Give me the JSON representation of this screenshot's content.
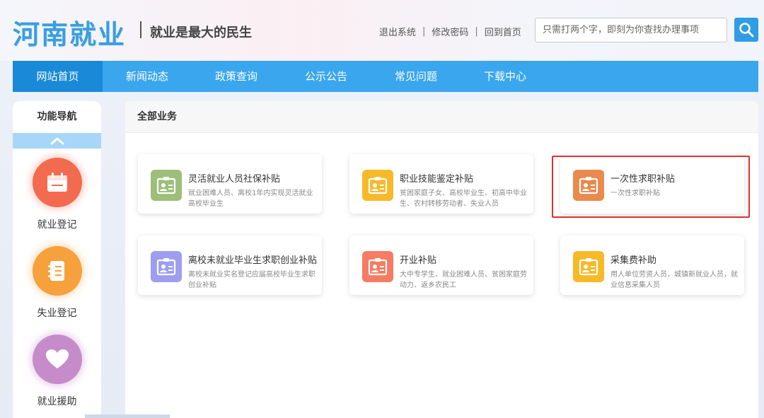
{
  "header": {
    "logo": "河南就业",
    "slogan": "就业是最大的民生",
    "links": [
      "退出系统",
      "修改密码",
      "回到首页"
    ],
    "search_placeholder": "只需打两个字，即刻为你查找办理事项"
  },
  "nav": {
    "items": [
      "网站首页",
      "新闻动态",
      "政策查询",
      "公示公告",
      "常见问题",
      "下载中心"
    ],
    "active_index": 0
  },
  "sidebar": {
    "title": "功能导航",
    "items": [
      {
        "label": "就业登记",
        "icon": "calendar-icon",
        "color": "#f26b4f"
      },
      {
        "label": "失业登记",
        "icon": "notebook-icon",
        "color": "#f7a13c"
      },
      {
        "label": "就业援助",
        "icon": "heart-icon",
        "color": "#c68cc9"
      }
    ]
  },
  "main": {
    "title": "全部业务",
    "cards": [
      {
        "title": "灵活就业人员社保补贴",
        "desc": "就业困难人员、离校1年内实现灵活就业高校毕业生",
        "color": "#9dbf7a"
      },
      {
        "title": "职业技能鉴定补贴",
        "desc": "贫困家庭子女、高校毕业生、初高中毕业生、农村转移劳动者、失业人员",
        "color": "#f7b928"
      },
      {
        "title": "一次性求职补贴",
        "desc": "一次性求职补贴",
        "color": "#ea8a4c"
      },
      {
        "title": "离校未就业毕业生求职创业补贴",
        "desc": "离校未就业实名登记应届高校毕业生求职创业补贴",
        "color": "#9d9ef0"
      },
      {
        "title": "开业补贴",
        "desc": "大中专学生、就业困难人员、贫困家庭劳动力、返乡农民工",
        "color": "#f57b62"
      },
      {
        "title": "采集费补助",
        "desc": "用人单位劳资人员，城镇新就业人员，就业信息采集人员",
        "color": "#f7b928"
      }
    ]
  }
}
